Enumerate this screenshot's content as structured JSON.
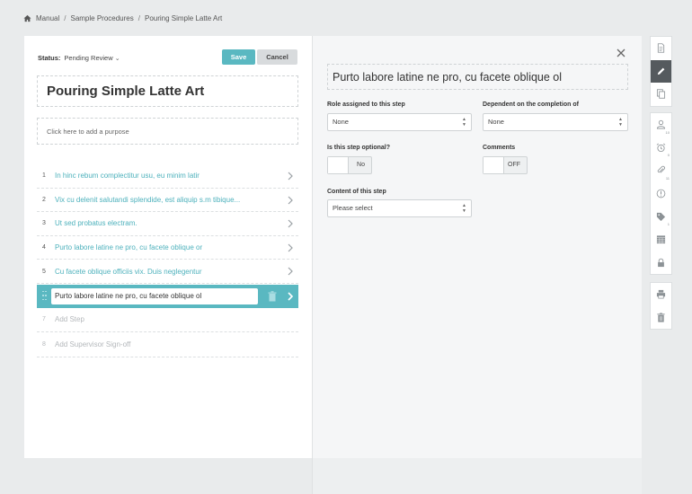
{
  "breadcrumb": {
    "items": [
      "Manual",
      "Sample Procedures",
      "Pouring Simple Latte Art"
    ],
    "separator": "/"
  },
  "editor": {
    "status_label": "Status:",
    "status_value": "Pending Review",
    "save_label": "Save",
    "cancel_label": "Cancel",
    "title": "Pouring Simple Latte Art",
    "purpose_placeholder": "Click here to add a purpose",
    "steps": [
      {
        "num": "1",
        "text": "In hinc rebum complectitur usu, eu minim latir"
      },
      {
        "num": "2",
        "text": "Vix cu delenit salutandi splendide, est aliquip s.m tibique..."
      },
      {
        "num": "3",
        "text": "Ut sed probatus electram."
      },
      {
        "num": "4",
        "text": "Purto labore latine ne pro, cu facete oblique or"
      },
      {
        "num": "5",
        "text": "Cu facete oblique officiis vix. Duis neglegentur"
      }
    ],
    "active_step_value": "Purto labore latine ne pro, cu facete oblique ol",
    "add_step": {
      "num": "7",
      "text": "Add Step"
    },
    "add_signoff": {
      "num": "8",
      "text": "Add Supervisor Sign-off"
    }
  },
  "detail": {
    "step_title": "Purto labore latine ne pro, cu facete oblique ol",
    "role_label": "Role assigned to this step",
    "role_value": "None",
    "dependent_label": "Dependent on the completion of",
    "dependent_value": "None",
    "optional_label": "Is this step optional?",
    "optional_value": "No",
    "comments_label": "Comments",
    "comments_value": "OFF",
    "content_label": "Content of this step",
    "content_value": "Please select"
  },
  "rail": {
    "group1": [
      {
        "icon": "document-icon"
      },
      {
        "icon": "pencil-icon",
        "active": true
      },
      {
        "icon": "copy-icon"
      }
    ],
    "group2": [
      {
        "icon": "user-icon",
        "badge": "10"
      },
      {
        "icon": "alarm-icon",
        "badge": "0"
      },
      {
        "icon": "paperclip-icon",
        "badge": "11"
      },
      {
        "icon": "alert-icon"
      },
      {
        "icon": "tag-icon",
        "badge": "1"
      },
      {
        "icon": "calendar-icon"
      },
      {
        "icon": "lock-icon"
      }
    ],
    "group3": [
      {
        "icon": "print-icon"
      },
      {
        "icon": "trash-icon"
      }
    ]
  },
  "colors": {
    "accent": "#5ab8c1",
    "link": "#4db1bc",
    "muted": "#b4b8bb",
    "background": "#e9ebec",
    "rail_active": "#555a5e"
  }
}
